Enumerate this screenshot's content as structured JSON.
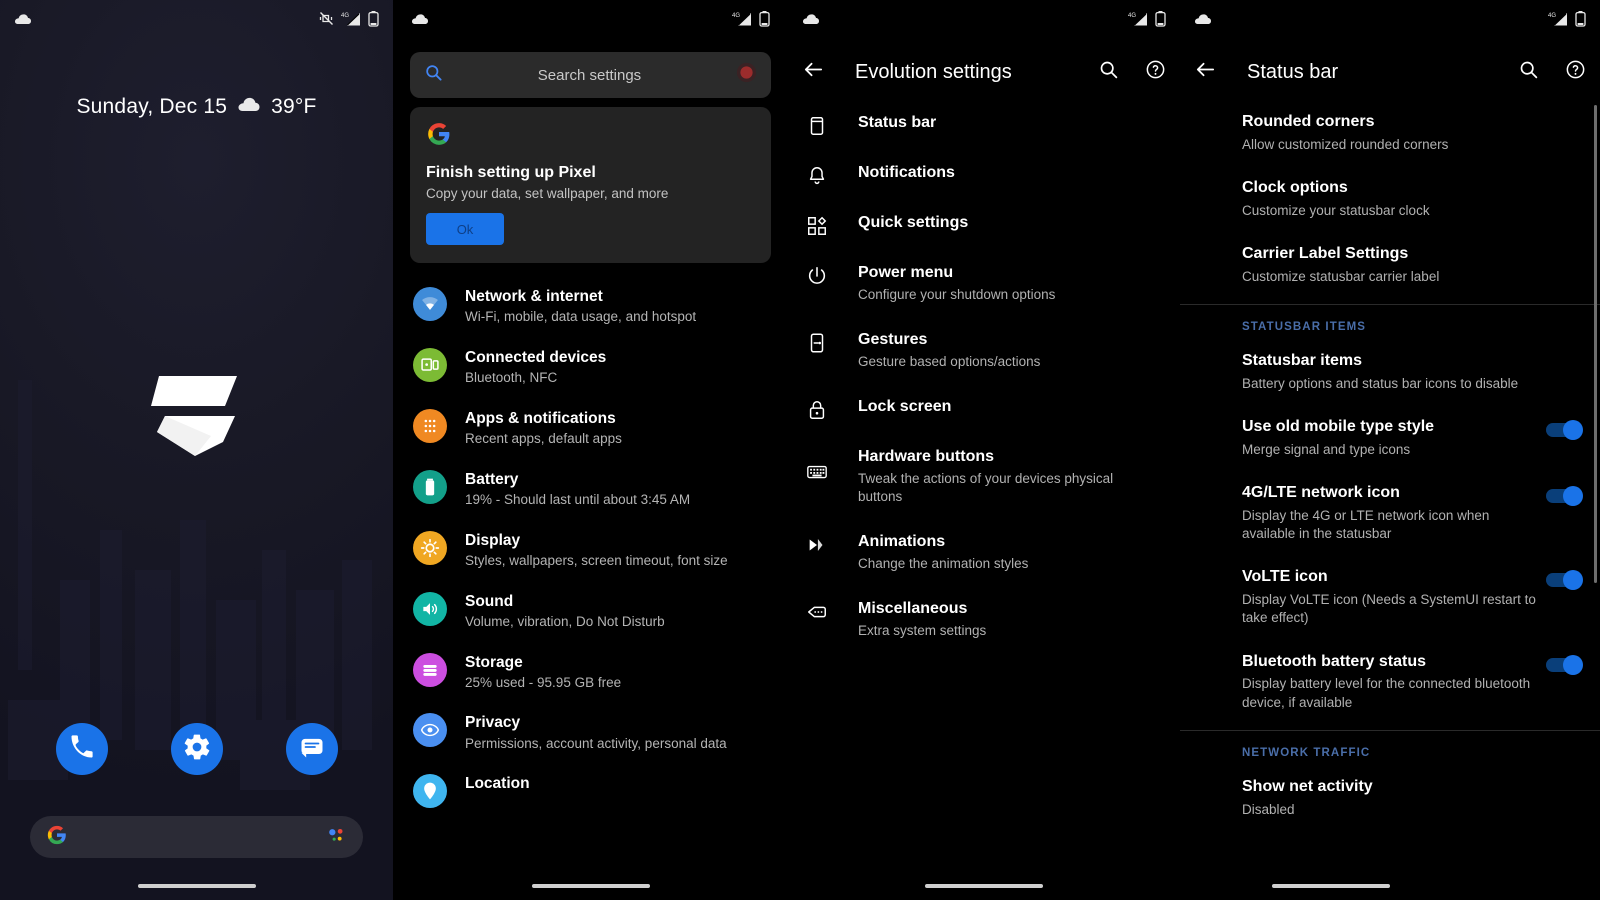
{
  "home": {
    "statusbar": {
      "left_icons": [
        "cloud-icon"
      ],
      "right_icons": [
        "vibrate-off-icon",
        "signal-4g-icon",
        "battery-icon"
      ]
    },
    "widget": {
      "date": "Sunday, Dec 15",
      "weather_icon": "cloud-icon",
      "temperature": "39°F"
    },
    "dock": [
      {
        "name": "phone",
        "icon": "phone-icon"
      },
      {
        "name": "settings",
        "icon": "gear-icon"
      },
      {
        "name": "messages",
        "icon": "message-icon"
      }
    ],
    "search": {
      "icon": "google-g-icon",
      "assistant_icon": "google-assistant-icon"
    }
  },
  "settings": {
    "statusbar": {
      "left_icons": [
        "cloud-icon"
      ],
      "right_icons": [
        "signal-4g-icon",
        "battery-icon"
      ]
    },
    "search": {
      "placeholder": "Search settings",
      "icon": "search-icon",
      "avatar": "account-avatar"
    },
    "card": {
      "icon": "google-g-icon",
      "title": "Finish setting up Pixel",
      "subtitle": "Copy your data, set wallpaper, and more",
      "button": "Ok"
    },
    "items": [
      {
        "title": "Network & internet",
        "subtitle": "Wi-Fi, mobile, data usage, and hotspot",
        "icon": "wifi-icon",
        "color": "#3f8bd8"
      },
      {
        "title": "Connected devices",
        "subtitle": "Bluetooth, NFC",
        "icon": "cast-icon",
        "color": "#7cbb34"
      },
      {
        "title": "Apps & notifications",
        "subtitle": "Recent apps, default apps",
        "icon": "apps-grid-icon",
        "color": "#f08922"
      },
      {
        "title": "Battery",
        "subtitle": "19% - Should last until about 3:45 AM",
        "icon": "battery-icon",
        "color": "#13a08a"
      },
      {
        "title": "Display",
        "subtitle": "Styles, wallpapers, screen timeout, font size",
        "icon": "brightness-icon",
        "color": "#f0a722"
      },
      {
        "title": "Sound",
        "subtitle": "Volume, vibration, Do Not Disturb",
        "icon": "volume-icon",
        "color": "#12b5a5"
      },
      {
        "title": "Storage",
        "subtitle": "25% used - 95.95 GB free",
        "icon": "storage-icon",
        "color": "#cc4ee0"
      },
      {
        "title": "Privacy",
        "subtitle": "Permissions, account activity, personal data",
        "icon": "privacy-eye-icon",
        "color": "#4a8ff0"
      },
      {
        "title": "Location",
        "subtitle": "",
        "icon": "location-icon",
        "color": "#3fb5ef"
      }
    ]
  },
  "evolution": {
    "statusbar": {
      "left_icons": [
        "cloud-icon"
      ],
      "right_icons": [
        "signal-4g-icon",
        "battery-icon"
      ]
    },
    "appbar": {
      "title": "Evolution settings",
      "back_icon": "back-arrow-icon",
      "search_icon": "search-icon",
      "help_icon": "help-circle-icon"
    },
    "items": [
      {
        "title": "Status bar",
        "subtitle": "",
        "icon": "statusbar-icon"
      },
      {
        "title": "Notifications",
        "subtitle": "",
        "icon": "bell-icon"
      },
      {
        "title": "Quick settings",
        "subtitle": "",
        "icon": "quick-settings-icon"
      },
      {
        "title": "Power menu",
        "subtitle": "Configure your shutdown options",
        "icon": "power-icon"
      },
      {
        "title": "Gestures",
        "subtitle": "Gesture based options/actions",
        "icon": "gesture-icon"
      },
      {
        "title": "Lock screen",
        "subtitle": "",
        "icon": "lock-icon"
      },
      {
        "title": "Hardware buttons",
        "subtitle": "Tweak the actions of your devices physical buttons",
        "icon": "keyboard-icon"
      },
      {
        "title": "Animations",
        "subtitle": "Change the animation styles",
        "icon": "animation-icon"
      },
      {
        "title": "Miscellaneous",
        "subtitle": "Extra system settings",
        "icon": "misc-tag-icon"
      }
    ]
  },
  "statusbar_page": {
    "statusbar": {
      "left_icons": [
        "cloud-icon"
      ],
      "right_icons": [
        "signal-4g-icon",
        "battery-icon"
      ]
    },
    "appbar": {
      "title": "Status bar",
      "back_icon": "back-arrow-icon",
      "search_icon": "search-icon",
      "help_icon": "help-circle-icon"
    },
    "sections": [
      {
        "header": "",
        "items": [
          {
            "title": "Rounded corners",
            "subtitle": "Allow customized rounded corners",
            "toggle": null
          },
          {
            "title": "Clock options",
            "subtitle": "Customize your statusbar clock",
            "toggle": null
          },
          {
            "title": "Carrier Label Settings",
            "subtitle": "Customize statusbar carrier label",
            "toggle": null
          }
        ]
      },
      {
        "header": "STATUSBAR ITEMS",
        "items": [
          {
            "title": "Statusbar items",
            "subtitle": "Battery options and status bar icons to disable",
            "toggle": null
          },
          {
            "title": "Use old mobile type style",
            "subtitle": "Merge signal and type icons",
            "toggle": "on"
          },
          {
            "title": "4G/LTE network icon",
            "subtitle": "Display the 4G or LTE network icon when available in the statusbar",
            "toggle": "on"
          },
          {
            "title": "VoLTE icon",
            "subtitle": "Display VoLTE icon (Needs a SystemUI restart to take effect)",
            "toggle": "on"
          },
          {
            "title": "Bluetooth battery status",
            "subtitle": "Display battery level for the connected bluetooth device, if available",
            "toggle": "on"
          }
        ]
      },
      {
        "header": "NETWORK TRAFFIC",
        "items": [
          {
            "title": "Show net activity",
            "subtitle": "Disabled",
            "toggle": null
          }
        ]
      }
    ],
    "accent_color": "#1a73e8",
    "section_header_color": "#4a6ea9"
  }
}
